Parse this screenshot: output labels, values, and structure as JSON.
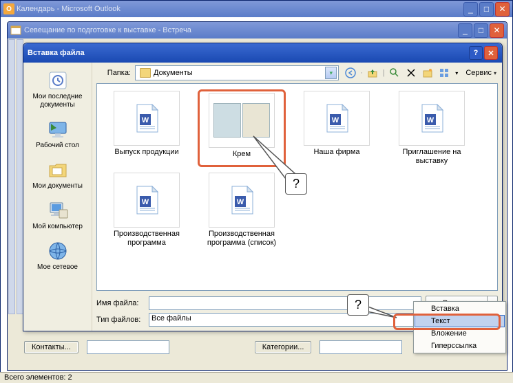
{
  "outer_window": {
    "title": "Календарь - Microsoft Outlook"
  },
  "inner_window": {
    "title": "Севещание по подготовке к выставке - Встреча"
  },
  "meeting_buttons": {
    "contacts": "Контакты...",
    "categories": "Категории..."
  },
  "statusbar": {
    "text": "Всего элементов: 2"
  },
  "dialog": {
    "title": "Вставка файла",
    "help": "?",
    "close": "✕",
    "folder_label": "Папка:",
    "folder_value": "Документы",
    "service_label": "Сервис",
    "filename_label": "Имя файла:",
    "filename_value": "",
    "filetype_label": "Тип файлов:",
    "filetype_value": "Все файлы",
    "insert_btn": "Вставка"
  },
  "places": [
    {
      "label": "Мои последние документы",
      "icon": "recent"
    },
    {
      "label": "Рабочий стол",
      "icon": "desktop"
    },
    {
      "label": "Мои документы",
      "icon": "mydocs"
    },
    {
      "label": "Мой компьютер",
      "icon": "mycomp"
    },
    {
      "label": "Мое сетевое",
      "icon": "network"
    }
  ],
  "files": [
    {
      "name": "Выпуск продукции",
      "type": "word",
      "selected": false
    },
    {
      "name": "Крем",
      "type": "image",
      "selected": true
    },
    {
      "name": "Наша фирма",
      "type": "word",
      "selected": false
    },
    {
      "name": "Приглашение на выставку",
      "type": "word",
      "selected": false
    },
    {
      "name": "Производственная программа",
      "type": "word",
      "selected": false
    },
    {
      "name": "Производственная программа (список)",
      "type": "word",
      "selected": false
    }
  ],
  "dropdown": {
    "items": [
      "Вставка",
      "Текст",
      "Вложение",
      "Гиперссылка"
    ],
    "selected_index": 1
  },
  "annotations": {
    "q": "?"
  }
}
